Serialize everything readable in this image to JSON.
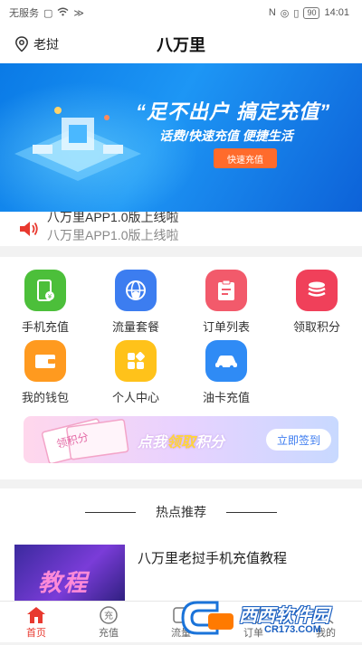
{
  "status_bar": {
    "left_text": "无服务",
    "battery": "90",
    "time": "14:01"
  },
  "header": {
    "location": "老挝",
    "title": "八万里"
  },
  "banner": {
    "slogan": "“足不出户  搞定充值”",
    "subtitle": "话费/快速充值   便捷生活",
    "button": "快速充值"
  },
  "notice": {
    "lines": [
      "八万里APP1.0版上线啦",
      "八万里APP1.0版上线啦"
    ]
  },
  "menu": {
    "items": [
      {
        "label": "手机充值",
        "icon": "phone-recharge-icon",
        "color": "#4cbf3a"
      },
      {
        "label": "流量套餐",
        "icon": "data-plan-icon",
        "color": "#3c7df0"
      },
      {
        "label": "订单列表",
        "icon": "order-list-icon",
        "color": "#f25a6b"
      },
      {
        "label": "领取积分",
        "icon": "points-icon",
        "color": "#f0405a"
      },
      {
        "label": "我的钱包",
        "icon": "wallet-icon",
        "color": "#ff9a1f"
      },
      {
        "label": "个人中心",
        "icon": "profile-grid-icon",
        "color": "#ffc21a"
      },
      {
        "label": "油卡充值",
        "icon": "car-icon",
        "color": "#2f8bf5"
      }
    ]
  },
  "sign_banner": {
    "prefix": "点我",
    "highlight": "领取",
    "suffix": "积分",
    "card": "领积分",
    "button": "立即签到"
  },
  "hot": {
    "title": "热点推荐",
    "article_title": "八万里老挝手机充值教程",
    "thumb_text": "教程"
  },
  "tabs": [
    {
      "label": "首页",
      "active": true
    },
    {
      "label": "充值",
      "active": false
    },
    {
      "label": "流量",
      "active": false
    },
    {
      "label": "订单",
      "active": false
    },
    {
      "label": "我的",
      "active": false
    }
  ],
  "watermark": {
    "brand": "西西软件园",
    "url": "CR173.COM"
  }
}
